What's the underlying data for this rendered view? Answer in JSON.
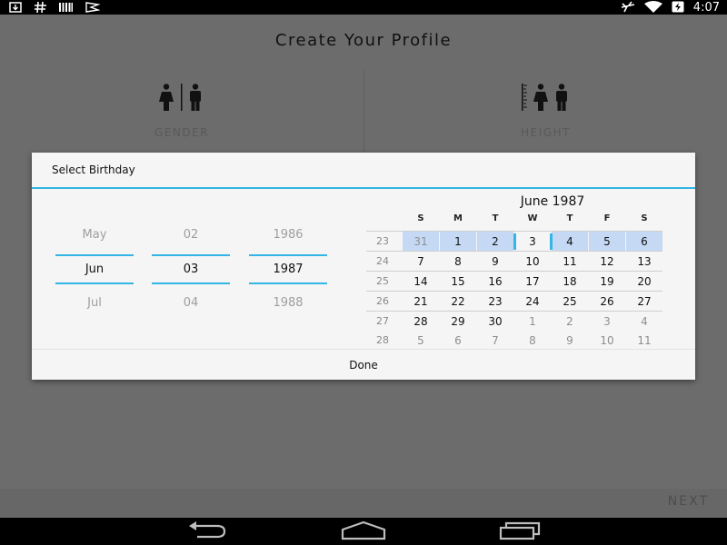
{
  "status_bar": {
    "left_icons": [
      "download-icon",
      "hash-icon",
      "barcode-icon",
      "flag-icon"
    ],
    "right_icons": [
      "airplane-mode-icon",
      "wifi-icon",
      "battery-charging-icon"
    ],
    "time": "4:07"
  },
  "app": {
    "title": "Create Your Profile",
    "tiles": [
      {
        "label": "GENDER",
        "icon": "gender-icon"
      },
      {
        "label": "HEIGHT",
        "icon": "height-icon"
      }
    ],
    "next_label": "NEXT"
  },
  "dialog": {
    "title": "Select Birthday",
    "spinners": {
      "month": {
        "prev": "May",
        "current": "Jun",
        "next": "Jul"
      },
      "day": {
        "prev": "02",
        "current": "03",
        "next": "04"
      },
      "year": {
        "prev": "1986",
        "current": "1987",
        "next": "1988"
      }
    },
    "calendar": {
      "title": "June 1987",
      "weekdays": [
        "S",
        "M",
        "T",
        "W",
        "T",
        "F",
        "S"
      ],
      "weeks": [
        {
          "week": "23",
          "days": [
            "31",
            "1",
            "2",
            "3",
            "4",
            "5",
            "6"
          ]
        },
        {
          "week": "24",
          "days": [
            "7",
            "8",
            "9",
            "10",
            "11",
            "12",
            "13"
          ]
        },
        {
          "week": "25",
          "days": [
            "14",
            "15",
            "16",
            "17",
            "18",
            "19",
            "20"
          ]
        },
        {
          "week": "26",
          "days": [
            "21",
            "22",
            "23",
            "24",
            "25",
            "26",
            "27"
          ]
        },
        {
          "week": "27",
          "days": [
            "28",
            "29",
            "30",
            "1",
            "2",
            "3",
            "4"
          ]
        },
        {
          "week": "28",
          "days": [
            "5",
            "6",
            "7",
            "8",
            "9",
            "10",
            "11"
          ]
        }
      ],
      "selected_date": "3",
      "colors": {
        "selected_week": "#c5d9f5",
        "accent": "#33b5e5"
      }
    },
    "done_label": "Done"
  },
  "nav_bar": {
    "icons": [
      "back-icon",
      "home-icon",
      "recents-icon"
    ]
  }
}
